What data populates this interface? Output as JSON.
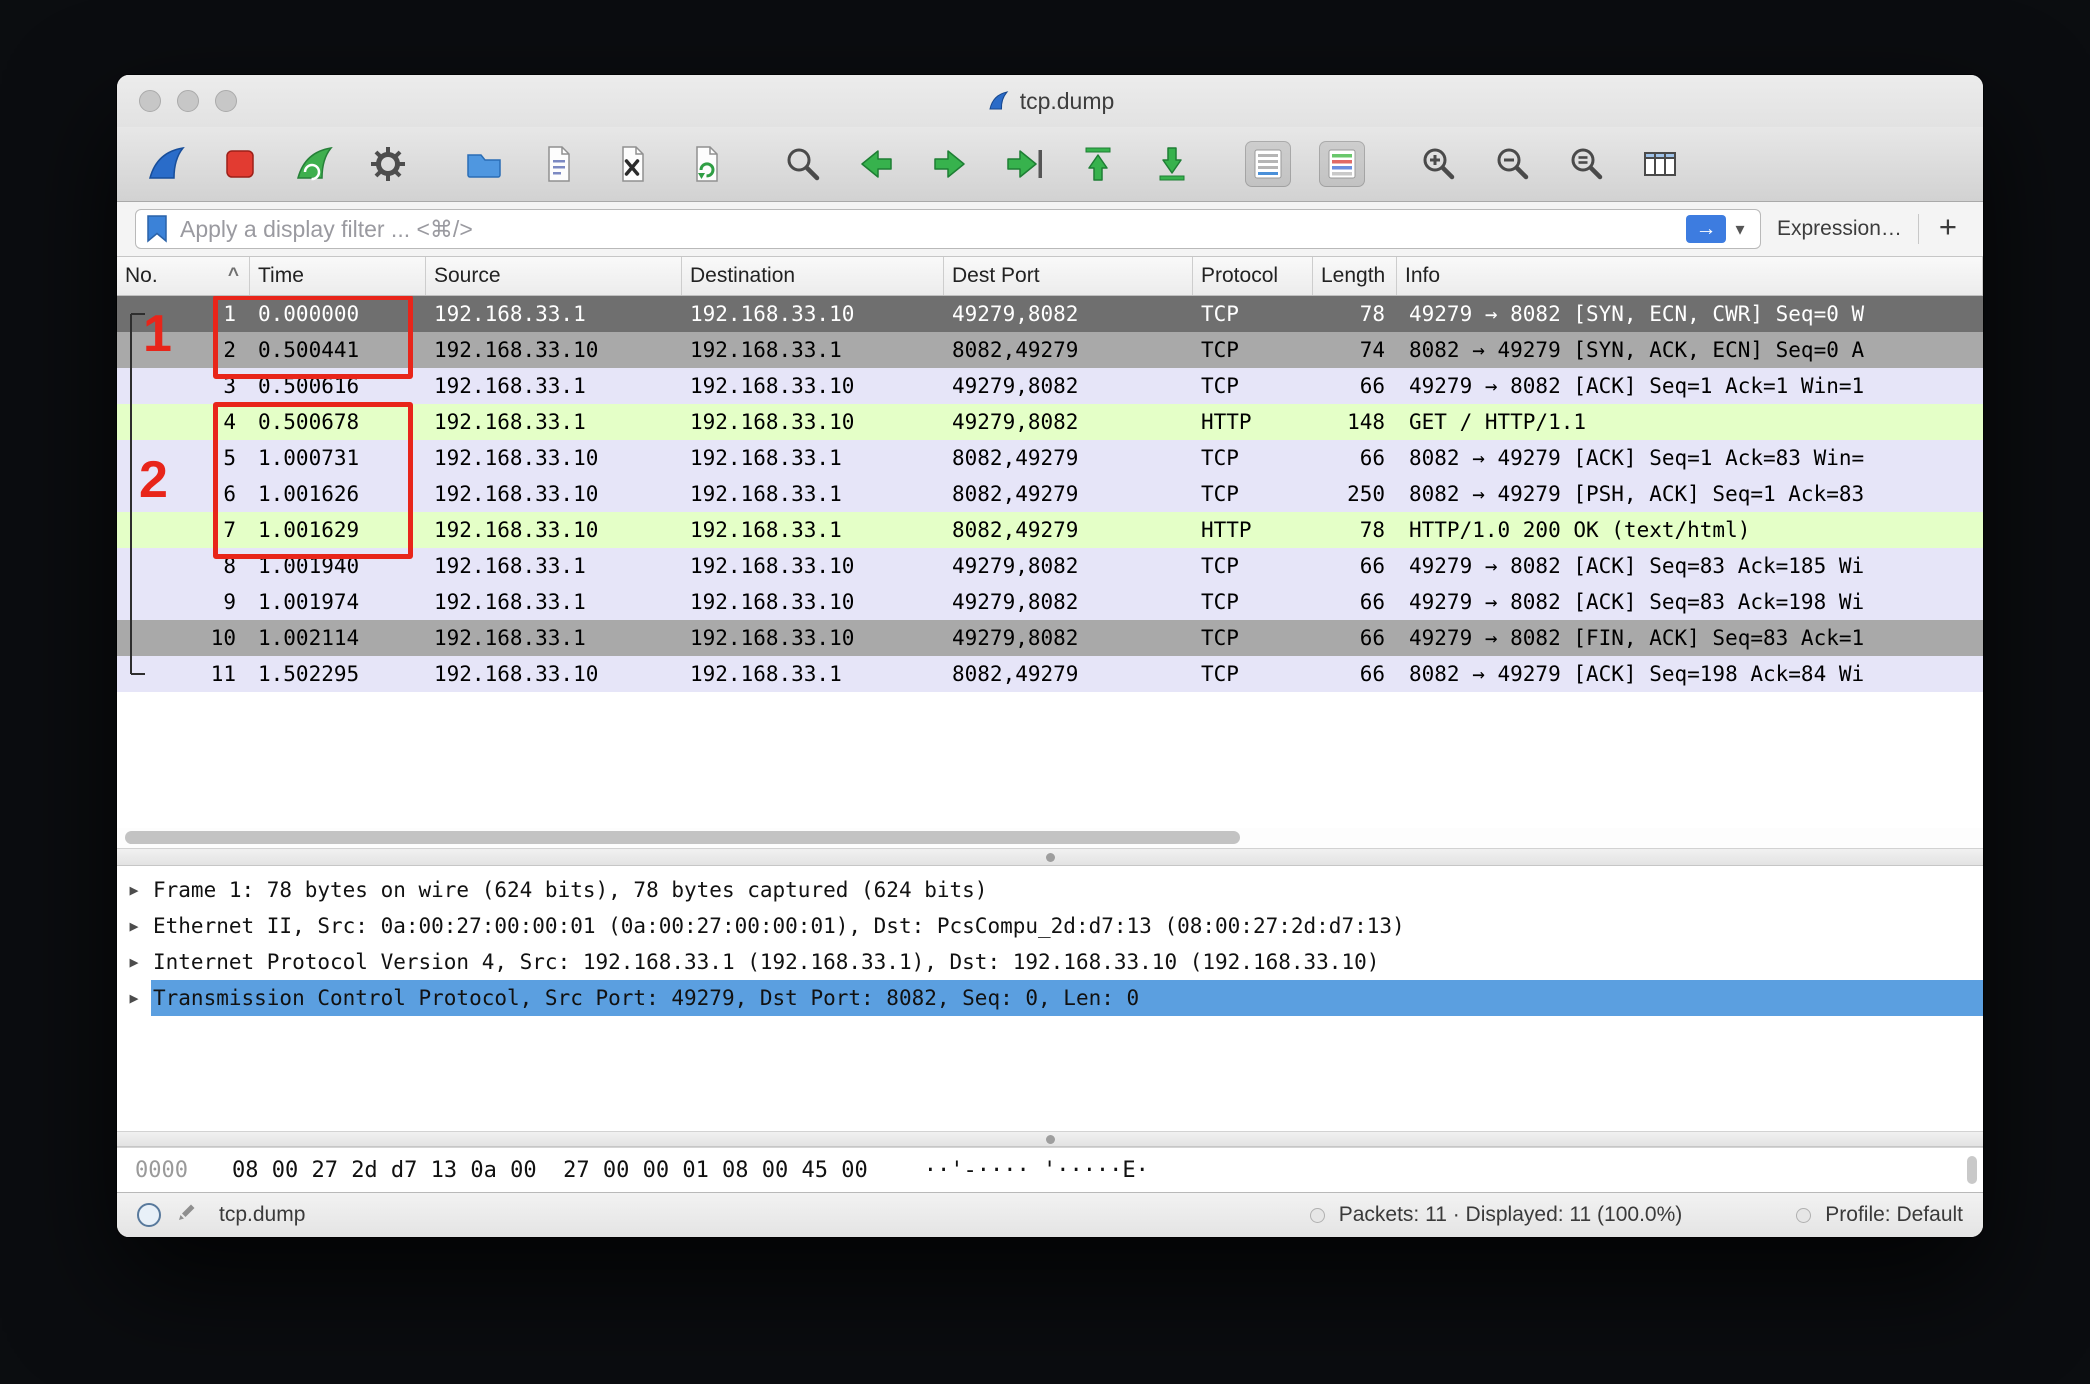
{
  "window": {
    "title": "tcp.dump"
  },
  "toolbar": {
    "buttons": [
      "start-capture",
      "stop-capture",
      "restart-capture",
      "capture-options",
      "open-file",
      "save-file",
      "close-file",
      "reload-file",
      "find-packet",
      "go-back",
      "go-forward",
      "go-to-packet",
      "go-to-first",
      "go-to-last",
      "auto-scroll-toggle",
      "colorize-toggle",
      "zoom-in",
      "zoom-out",
      "zoom-original",
      "resize-columns"
    ],
    "active_toggles": [
      "auto-scroll-toggle",
      "colorize-toggle"
    ]
  },
  "filter_bar": {
    "placeholder": "Apply a display filter ... <⌘/>",
    "expression_label": "Expression…",
    "add_label": "+"
  },
  "icons": {
    "apply_arrow": "→",
    "dropdown_caret": "▾",
    "disclosure": "▶"
  },
  "packet_list": {
    "columns": [
      {
        "label": "No.",
        "sort": "^"
      },
      {
        "label": "Time"
      },
      {
        "label": "Source"
      },
      {
        "label": "Destination"
      },
      {
        "label": "Dest Port"
      },
      {
        "label": "Protocol"
      },
      {
        "label": "Length"
      },
      {
        "label": "Info"
      }
    ],
    "rows": [
      {
        "no": "1",
        "time": "0.000000",
        "source": "192.168.33.1",
        "destination": "192.168.33.10",
        "dest_port": "49279,8082",
        "protocol": "TCP",
        "length": "78",
        "info": "49279 → 8082 [SYN, ECN, CWR] Seq=0 W",
        "cls": "row-selected"
      },
      {
        "no": "2",
        "time": "0.500441",
        "source": "192.168.33.10",
        "destination": "192.168.33.1",
        "dest_port": "8082,49279",
        "protocol": "TCP",
        "length": "74",
        "info": "8082 → 49279 [SYN, ACK, ECN] Seq=0 A",
        "cls": "row-gray"
      },
      {
        "no": "3",
        "time": "0.500616",
        "source": "192.168.33.1",
        "destination": "192.168.33.10",
        "dest_port": "49279,8082",
        "protocol": "TCP",
        "length": "66",
        "info": "49279 → 8082 [ACK] Seq=1 Ack=1 Win=1",
        "cls": "row-tcp"
      },
      {
        "no": "4",
        "time": "0.500678",
        "source": "192.168.33.1",
        "destination": "192.168.33.10",
        "dest_port": "49279,8082",
        "protocol": "HTTP",
        "length": "148",
        "info": "GET / HTTP/1.1 ",
        "cls": "row-http"
      },
      {
        "no": "5",
        "time": "1.000731",
        "source": "192.168.33.10",
        "destination": "192.168.33.1",
        "dest_port": "8082,49279",
        "protocol": "TCP",
        "length": "66",
        "info": "8082 → 49279 [ACK] Seq=1 Ack=83 Win=",
        "cls": "row-tcp"
      },
      {
        "no": "6",
        "time": "1.001626",
        "source": "192.168.33.10",
        "destination": "192.168.33.1",
        "dest_port": "8082,49279",
        "protocol": "TCP",
        "length": "250",
        "info": "8082 → 49279 [PSH, ACK] Seq=1 Ack=83",
        "cls": "row-tcp"
      },
      {
        "no": "7",
        "time": "1.001629",
        "source": "192.168.33.10",
        "destination": "192.168.33.1",
        "dest_port": "8082,49279",
        "protocol": "HTTP",
        "length": "78",
        "info": "HTTP/1.0 200 OK  (text/html)",
        "cls": "row-http"
      },
      {
        "no": "8",
        "time": "1.001940",
        "source": "192.168.33.1",
        "destination": "192.168.33.10",
        "dest_port": "49279,8082",
        "protocol": "TCP",
        "length": "66",
        "info": "49279 → 8082 [ACK] Seq=83 Ack=185 Wi",
        "cls": "row-tcp"
      },
      {
        "no": "9",
        "time": "1.001974",
        "source": "192.168.33.1",
        "destination": "192.168.33.10",
        "dest_port": "49279,8082",
        "protocol": "TCP",
        "length": "66",
        "info": "49279 → 8082 [ACK] Seq=83 Ack=198 Wi",
        "cls": "row-tcp"
      },
      {
        "no": "10",
        "time": "1.002114",
        "source": "192.168.33.1",
        "destination": "192.168.33.10",
        "dest_port": "49279,8082",
        "protocol": "TCP",
        "length": "66",
        "info": "49279 → 8082 [FIN, ACK] Seq=83 Ack=1",
        "cls": "row-gray"
      },
      {
        "no": "11",
        "time": "1.502295",
        "source": "192.168.33.10",
        "destination": "192.168.33.1",
        "dest_port": "8082,49279",
        "protocol": "TCP",
        "length": "66",
        "info": "8082 → 49279 [ACK] Seq=198 Ack=84 Wi",
        "cls": "row-tcp"
      }
    ]
  },
  "annotations": {
    "box1_label": "1",
    "box2_label": "2",
    "color": "#e8251a",
    "box1_rows": [
      1,
      2
    ],
    "box2_rows": [
      4,
      7
    ]
  },
  "details": {
    "rows": [
      {
        "text": "Frame 1: 78 bytes on wire (624 bits), 78 bytes captured (624 bits)"
      },
      {
        "text": "Ethernet II, Src: 0a:00:27:00:00:01 (0a:00:27:00:00:01), Dst: PcsCompu_2d:d7:13 (08:00:27:2d:d7:13)"
      },
      {
        "text": "Internet Protocol Version 4, Src: 192.168.33.1 (192.168.33.1), Dst: 192.168.33.10 (192.168.33.10)"
      },
      {
        "text": "Transmission Control Protocol, Src Port: 49279, Dst Port: 8082, Seq: 0, Len: 0",
        "cls": "selected"
      }
    ]
  },
  "hex_view": {
    "offset": "0000",
    "hex": "08 00 27 2d d7 13 0a 00  27 00 00 01 08 00 45 00",
    "ascii": "··'-···· '·····E·"
  },
  "status_bar": {
    "file_label": "tcp.dump",
    "packets_label": "Packets: 11 · Displayed: 11 (100.0%)",
    "profile_label": "Profile: Default"
  }
}
